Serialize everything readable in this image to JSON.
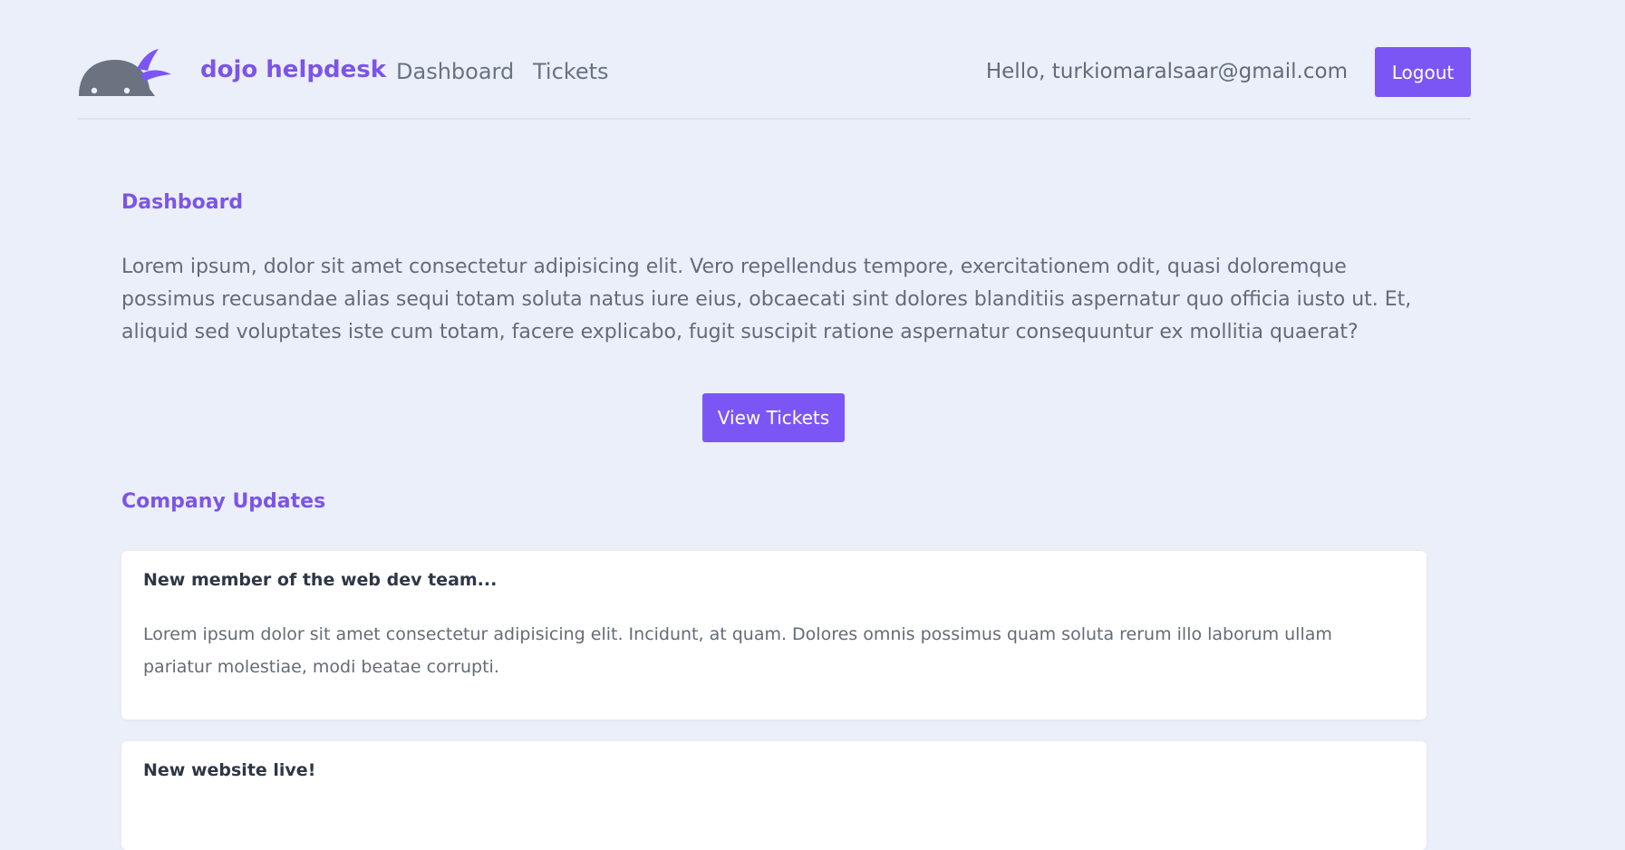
{
  "nav": {
    "brand": "dojo helpdesk",
    "links": [
      "Dashboard",
      "Tickets"
    ],
    "greeting": "Hello, turkiomaralsaar@gmail.com",
    "logout_label": "Logout"
  },
  "dashboard": {
    "title": "Dashboard",
    "intro": "Lorem ipsum, dolor sit amet consectetur adipisicing elit. Vero repellendus tempore, exercitationem odit, quasi doloremque possimus recusandae alias sequi totam soluta natus iure eius, obcaecati sint dolores blanditiis aspernatur quo officia iusto ut. Et, aliquid sed voluptates iste cum totam, facere explicabo, fugit suscipit ratione aspernatur consequuntur ex mollitia quaerat?",
    "view_tickets_label": "View Tickets"
  },
  "updates": {
    "title": "Company Updates",
    "items": [
      {
        "title": "New member of the web dev team...",
        "body": "Lorem ipsum dolor sit amet consectetur adipisicing elit. Incidunt, at quam. Dolores omnis possimus quam soluta rerum illo laborum ullam pariatur molestiae, modi beatae corrupti."
      },
      {
        "title": "New website live!",
        "body": ""
      }
    ]
  },
  "colors": {
    "background": "#ebeff9",
    "accent": "#7b56f5",
    "heading": "#7c55e6",
    "logo_gray": "#6b7380"
  },
  "icons": {
    "logo": "ninja-logo-icon"
  }
}
